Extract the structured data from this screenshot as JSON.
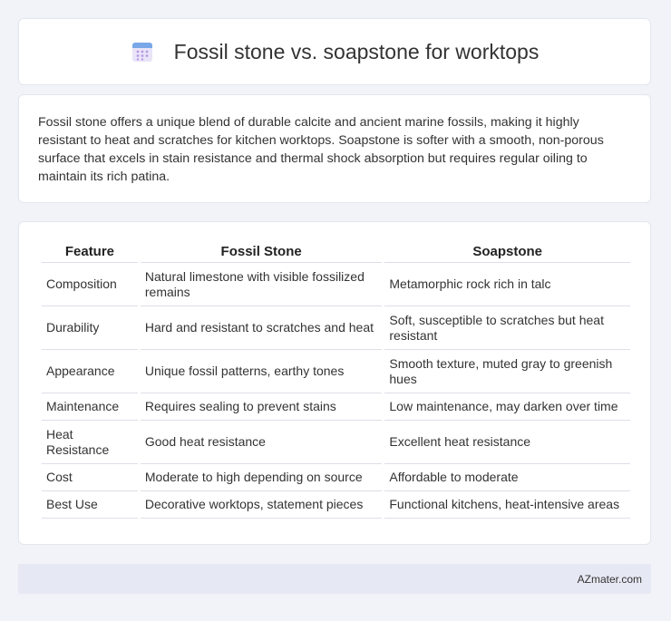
{
  "header": {
    "title": "Fossil stone vs. soapstone for worktops",
    "icon": "calendar-icon",
    "icon_colors": {
      "top": "#7aa7e8",
      "body": "#e9e4f7",
      "dots": "#b79be3"
    }
  },
  "intro": {
    "text": "Fossil stone offers a unique blend of durable calcite and ancient marine fossils, making it highly resistant to heat and scratches for kitchen worktops. Soapstone is softer with a smooth, non-porous surface that excels in stain resistance and thermal shock absorption but requires regular oiling to maintain its rich patina."
  },
  "table": {
    "headers": [
      "Feature",
      "Fossil Stone",
      "Soapstone"
    ],
    "rows": [
      {
        "feature": "Composition",
        "fossil": "Natural limestone with visible fossilized remains",
        "soap": "Metamorphic rock rich in talc"
      },
      {
        "feature": "Durability",
        "fossil": "Hard and resistant to scratches and heat",
        "soap": "Soft, susceptible to scratches but heat resistant"
      },
      {
        "feature": "Appearance",
        "fossil": "Unique fossil patterns, earthy tones",
        "soap": "Smooth texture, muted gray to greenish hues"
      },
      {
        "feature": "Maintenance",
        "fossil": "Requires sealing to prevent stains",
        "soap": "Low maintenance, may darken over time"
      },
      {
        "feature": "Heat Resistance",
        "fossil": "Good heat resistance",
        "soap": "Excellent heat resistance"
      },
      {
        "feature": "Cost",
        "fossil": "Moderate to high depending on source",
        "soap": "Affordable to moderate"
      },
      {
        "feature": "Best Use",
        "fossil": "Decorative worktops, statement pieces",
        "soap": "Functional kitchens, heat-intensive areas"
      }
    ]
  },
  "footer": {
    "brand": "AZmater.com"
  }
}
